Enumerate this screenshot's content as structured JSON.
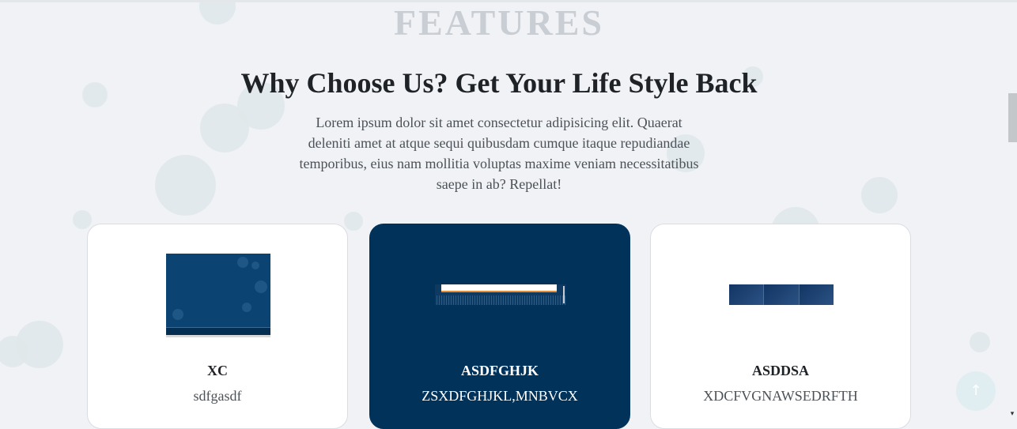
{
  "section": {
    "tag": "FEATURES",
    "heading": "Why Choose Us? Get Your Life Style Back",
    "description": "Lorem ipsum dolor sit amet consectetur adipisicing elit. Quaerat deleniti amet at atque sequi quibusdam cumque itaque repudiandae temporibus, eius nam mollitia voluptas maxime veniam necessitatibus saepe in ab? Repellat!"
  },
  "cards": [
    {
      "title": "XC",
      "subtitle": "sdfgasdf",
      "active": false
    },
    {
      "title": "ASDFGHJK",
      "subtitle": "ZSXDFGHJKL,MNBVCX",
      "active": true
    },
    {
      "title": "ASDDSA",
      "subtitle": "XDCFVGNAWSEDRFTH",
      "active": false
    }
  ],
  "icons": {
    "back_to_top": "arrow-up-icon",
    "scroll_down": "chevron-down-icon"
  },
  "colors": {
    "background": "#f0f2f5",
    "active_card": "#00325a",
    "heading": "#1f2327",
    "tag": "#c9ced4"
  }
}
